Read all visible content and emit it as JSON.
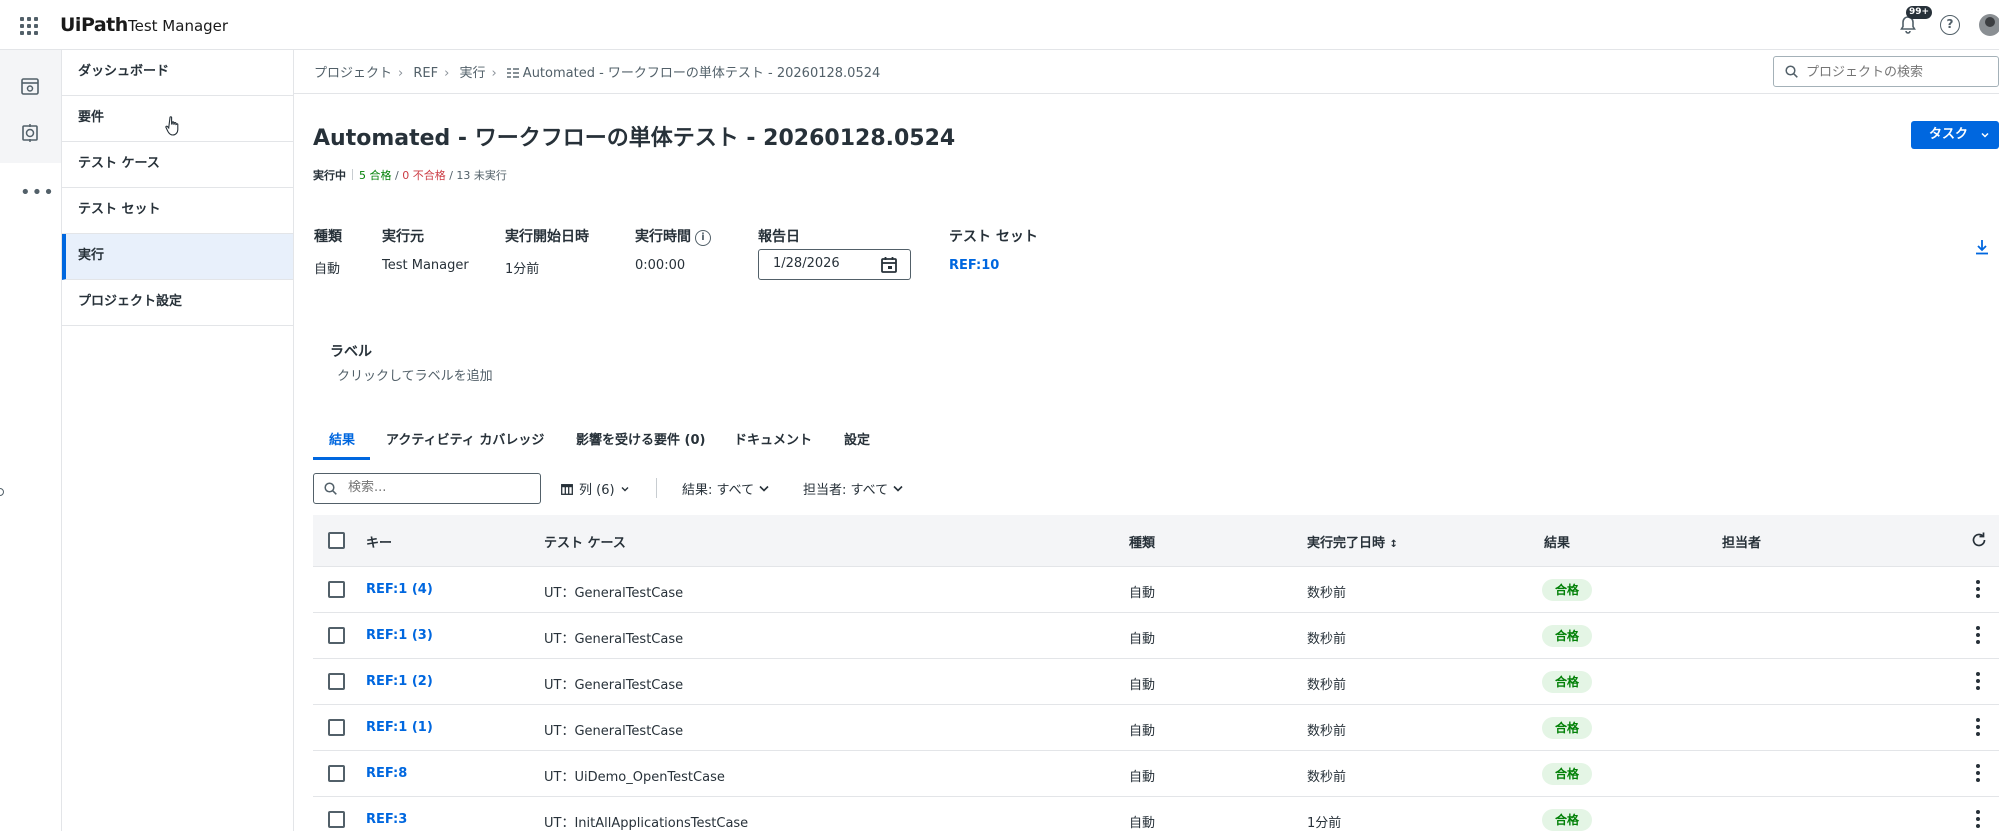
{
  "app": {
    "logo": "UiPath",
    "product": "Test Manager",
    "notification_badge": "99+"
  },
  "rail": {
    "icons": [
      "project-icon",
      "target-icon"
    ]
  },
  "sidebar": {
    "items": [
      {
        "label": "ダッシュボード",
        "active": false
      },
      {
        "label": "要件",
        "active": false
      },
      {
        "label": "テスト ケース",
        "active": false
      },
      {
        "label": "テスト セット",
        "active": false
      },
      {
        "label": "実行",
        "active": true
      },
      {
        "label": "プロジェクト設定",
        "active": false
      }
    ]
  },
  "breadcrumb": {
    "items": [
      "プロジェクト",
      "REF",
      "実行",
      "Automated - ワークフローの単体テスト - 20260128.0524"
    ]
  },
  "search": {
    "placeholder": "プロジェクトの検索"
  },
  "page": {
    "title": "Automated - ワークフローの単体テスト - 20260128.0524",
    "task_button": "タスク",
    "status": {
      "state": "実行中",
      "passed": "5 合格",
      "failed": "0 不合格",
      "not_run": "13 未実行"
    }
  },
  "meta": {
    "type_label": "種類",
    "type_value": "自動",
    "source_label": "実行元",
    "source_value": "Test Manager",
    "start_label": "実行開始日時",
    "start_value": "1分前",
    "duration_label": "実行時間",
    "duration_value": "0:00:00",
    "report_label": "報告日",
    "report_value": "1/28/2026",
    "testset_label": "テスト セット",
    "testset_value": "REF:10"
  },
  "labels": {
    "title": "ラベル",
    "add_text": "クリックしてラベルを追加"
  },
  "tabs": [
    {
      "label": "結果",
      "active": true
    },
    {
      "label": "アクティビティ カバレッジ",
      "active": false
    },
    {
      "label": "影響を受ける要件 (0)",
      "active": false
    },
    {
      "label": "ドキュメント",
      "active": false
    },
    {
      "label": "設定",
      "active": false
    }
  ],
  "toolbar": {
    "search_placeholder": "検索...",
    "columns_label": "列 (6)",
    "result_filter": "結果: すべて",
    "assignee_filter": "担当者: すべて"
  },
  "table": {
    "headers": {
      "key": "キー",
      "testcase": "テスト ケース",
      "type": "種類",
      "finished": "実行完了日時",
      "result": "結果",
      "assignee": "担当者"
    },
    "rows": [
      {
        "key": "REF:1 (4)",
        "testcase": "UT：GeneralTestCase",
        "type": "自動",
        "finished": "数秒前",
        "result": "合格",
        "assignee": ""
      },
      {
        "key": "REF:1 (3)",
        "testcase": "UT：GeneralTestCase",
        "type": "自動",
        "finished": "数秒前",
        "result": "合格",
        "assignee": ""
      },
      {
        "key": "REF:1 (2)",
        "testcase": "UT：GeneralTestCase",
        "type": "自動",
        "finished": "数秒前",
        "result": "合格",
        "assignee": ""
      },
      {
        "key": "REF:1 (1)",
        "testcase": "UT：GeneralTestCase",
        "type": "自動",
        "finished": "数秒前",
        "result": "合格",
        "assignee": ""
      },
      {
        "key": "REF:8",
        "testcase": "UT：UiDemo_OpenTestCase",
        "type": "自動",
        "finished": "数秒前",
        "result": "合格",
        "assignee": ""
      },
      {
        "key": "REF:3",
        "testcase": "UT：InitAllApplicationsTestCase",
        "type": "自動",
        "finished": "1分前",
        "result": "合格",
        "assignee": ""
      }
    ]
  },
  "colors": {
    "accent": "#0067df",
    "pass": "#038108",
    "fail": "#cc3d45",
    "text": "#273139"
  }
}
